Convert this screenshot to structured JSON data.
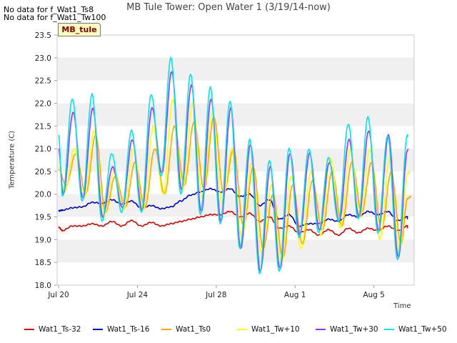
{
  "no_data_messages": [
    "No data for f_Wat1_Ts8",
    "No data for f_Wat1_Tw100"
  ],
  "site_label": "MB_tule",
  "chart_data": {
    "type": "line",
    "title": "MB Tule Tower: Open Water 1 (3/19/14-now)",
    "xlabel": "Time",
    "ylabel": "Temperature (C)",
    "ylim": [
      18.0,
      23.5
    ],
    "y_ticks": [
      18.0,
      18.5,
      19.0,
      19.5,
      20.0,
      20.5,
      21.0,
      21.5,
      22.0,
      22.5,
      23.0,
      23.5
    ],
    "y_tick_labels": [
      "18.0",
      "18.5",
      "19.0",
      "19.5",
      "20.0",
      "20.5",
      "21.0",
      "21.5",
      "22.0",
      "22.5",
      "23.0",
      "23.5"
    ],
    "xlim": [
      "2014-07-20",
      "2014-08-08"
    ],
    "x_ticks": [
      "Jul 20",
      "Jul 24",
      "Jul 28",
      "Aug 1",
      "Aug 5"
    ],
    "grid": "horizontal bands",
    "legend_position": "bottom",
    "days": [
      0.5,
      1.5,
      2.5,
      3.5,
      4.5,
      5.5,
      6.5,
      7.5,
      8.5,
      9.5,
      10.5,
      11.5,
      12.5,
      13.5,
      14.5,
      15.5,
      16.5,
      17.5
    ],
    "series": [
      {
        "name": "Wat1_Ts-32",
        "color": "#dd0000",
        "lag": 0.0,
        "start": 19.27,
        "mins": [
          19.2,
          19.3,
          19.3,
          19.3,
          19.3,
          19.3,
          19.4,
          19.5,
          19.55,
          19.5,
          19.4,
          19.25,
          19.15,
          19.1,
          19.1,
          19.15,
          19.2,
          19.2
        ],
        "maxs": [
          19.3,
          19.35,
          19.4,
          19.42,
          19.38,
          19.35,
          19.45,
          19.55,
          19.62,
          19.58,
          19.5,
          19.3,
          19.22,
          19.22,
          19.25,
          19.25,
          19.3,
          19.3
        ]
      },
      {
        "name": "Wat1_Ts-16",
        "color": "#0000cc",
        "lag": 0.0,
        "start": 19.63,
        "mins": [
          19.65,
          19.72,
          19.8,
          19.78,
          19.7,
          19.68,
          19.85,
          20.05,
          20.05,
          19.95,
          19.75,
          19.45,
          19.3,
          19.35,
          19.4,
          19.5,
          19.55,
          19.42
        ],
        "maxs": [
          19.7,
          19.82,
          19.88,
          19.85,
          19.75,
          19.72,
          19.98,
          20.12,
          20.12,
          20.0,
          19.88,
          19.55,
          19.35,
          19.45,
          19.55,
          19.62,
          19.62,
          19.5
        ]
      },
      {
        "name": "Wat1_Ts0",
        "color": "#ffa500",
        "lag": 0.18,
        "start": 20.55,
        "mins": [
          20.2,
          20.0,
          19.6,
          19.7,
          19.7,
          20.0,
          20.2,
          20.1,
          20.0,
          19.3,
          18.8,
          18.6,
          18.9,
          19.2,
          19.3,
          19.6,
          19.2,
          18.9
        ],
        "maxs": [
          20.9,
          21.3,
          20.4,
          20.7,
          21.0,
          21.5,
          21.6,
          21.7,
          21.0,
          20.6,
          20.0,
          20.2,
          20.3,
          20.5,
          20.7,
          20.7,
          20.5,
          19.95
        ]
      },
      {
        "name": "Wat1_Tw+10",
        "color": "#ffff00",
        "lag": 0.1,
        "start": 20.6,
        "mins": [
          20.05,
          19.9,
          19.5,
          19.65,
          19.65,
          20.0,
          20.1,
          19.9,
          19.8,
          19.0,
          18.7,
          18.5,
          18.8,
          19.1,
          19.25,
          19.5,
          19.0,
          18.7
        ],
        "maxs": [
          21.0,
          21.4,
          20.5,
          21.0,
          21.5,
          22.1,
          22.0,
          21.8,
          21.0,
          20.7,
          20.2,
          20.4,
          20.5,
          20.8,
          21.0,
          21.0,
          20.8,
          20.5
        ]
      },
      {
        "name": "Wat1_Tw+30",
        "color": "#9933ff",
        "lag": 0.04,
        "start": 21.0,
        "mins": [
          20.0,
          19.9,
          19.5,
          19.7,
          19.65,
          20.45,
          20.1,
          19.6,
          19.4,
          18.8,
          18.3,
          18.35,
          19.1,
          19.2,
          19.4,
          19.5,
          19.2,
          18.6
        ],
        "maxs": [
          21.8,
          21.9,
          20.6,
          21.2,
          21.9,
          22.7,
          22.4,
          22.1,
          21.9,
          21.1,
          20.6,
          20.9,
          20.9,
          20.7,
          21.2,
          21.4,
          21.3,
          21.0
        ]
      },
      {
        "name": "Wat1_Tw+50",
        "color": "#00e5ee",
        "lag": 0.0,
        "start": 21.3,
        "mins": [
          19.95,
          19.85,
          19.4,
          19.6,
          19.6,
          20.4,
          20.0,
          19.55,
          19.35,
          18.8,
          18.25,
          18.3,
          19.05,
          19.15,
          19.4,
          19.45,
          19.15,
          18.55
        ],
        "maxs": [
          22.1,
          22.2,
          20.9,
          21.4,
          22.2,
          23.0,
          22.65,
          22.35,
          22.05,
          21.2,
          20.75,
          21.0,
          21.0,
          20.8,
          21.55,
          21.7,
          21.3,
          21.3
        ]
      }
    ]
  }
}
